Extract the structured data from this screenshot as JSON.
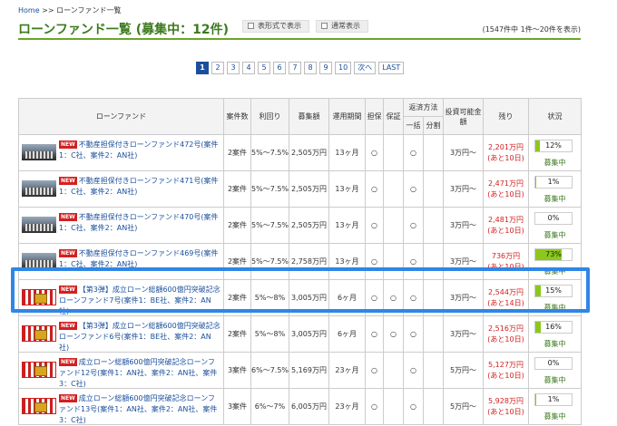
{
  "breadcrumb": {
    "home": "Home",
    "sep": ">>",
    "current": "ローンファンド一覧"
  },
  "title": "ローンファンド一覧 (募集中：12件)",
  "view_buttons": {
    "table": "表形式で表示",
    "normal": "通常表示"
  },
  "result_count": "(1547件中 1件〜20件を表示)",
  "pager": {
    "pages": [
      "1",
      "2",
      "3",
      "4",
      "5",
      "6",
      "7",
      "8",
      "9",
      "10"
    ],
    "current": "1",
    "next": "次へ",
    "last": "LAST"
  },
  "table": {
    "headers": {
      "fund": "ローンファンド",
      "cases": "案件数",
      "yield": "利回り",
      "amount": "募集額",
      "period": "運用期間",
      "collateral": "担保",
      "guarantee": "保証",
      "repayment": "返済方法",
      "lump": "一括",
      "installment": "分割",
      "min_invest": "投資可能金額",
      "remaining": "残り",
      "status": "状況"
    },
    "rows": [
      {
        "thumb": "city",
        "badge": "NEW",
        "name": "不動産担保付きローンファンド472号(案件1：C社、案件2：AN社)",
        "cases": "2案件",
        "yield": "5%〜7.5%",
        "amount": "2,505万円",
        "period": "13ヶ月",
        "collateral": "○",
        "guarantee": "",
        "lump": "○",
        "installment": "",
        "min_invest": "3万円〜",
        "remaining": "2,201万円",
        "remaining_days": "(あと10日)",
        "progress_label": "12%",
        "progress": 12,
        "status": "募集中"
      },
      {
        "thumb": "city",
        "badge": "NEW",
        "name": "不動産担保付きローンファンド471号(案件1：C社、案件2：AN社)",
        "cases": "2案件",
        "yield": "5%〜7.5%",
        "amount": "2,505万円",
        "period": "13ヶ月",
        "collateral": "○",
        "guarantee": "",
        "lump": "○",
        "installment": "",
        "min_invest": "3万円〜",
        "remaining": "2,471万円",
        "remaining_days": "(あと10日)",
        "progress_label": "1%",
        "progress": 1,
        "status": "募集中"
      },
      {
        "thumb": "city",
        "badge": "NEW",
        "name": "不動産担保付きローンファンド470号(案件1：C社、案件2：AN社)",
        "cases": "2案件",
        "yield": "5%〜7.5%",
        "amount": "2,505万円",
        "period": "13ヶ月",
        "collateral": "○",
        "guarantee": "",
        "lump": "○",
        "installment": "",
        "min_invest": "3万円〜",
        "remaining": "2,481万円",
        "remaining_days": "(あと10日)",
        "progress_label": "0%",
        "progress": 0,
        "status": "募集中"
      },
      {
        "thumb": "city",
        "badge": "NEW",
        "name": "不動産担保付きローンファンド469号(案件1：C社、案件2：AN社)",
        "cases": "2案件",
        "yield": "5%〜7.5%",
        "amount": "2,758万円",
        "period": "13ヶ月",
        "collateral": "○",
        "guarantee": "",
        "lump": "○",
        "installment": "",
        "min_invest": "3万円〜",
        "remaining": "736万円",
        "remaining_days": "(あと10日)",
        "progress_label": "73%",
        "progress": 73,
        "status": "募集中"
      },
      {
        "thumb": "red",
        "badge": "NEW",
        "name": "【第3弾】成立ローン総額600億円突破記念ローンファンド7号(案件1：BE社、案件2：AN社)",
        "cases": "2案件",
        "yield": "5%〜8%",
        "amount": "3,005万円",
        "period": "6ヶ月",
        "collateral": "○",
        "guarantee": "○",
        "lump": "○",
        "installment": "",
        "min_invest": "3万円〜",
        "remaining": "2,544万円",
        "remaining_days": "(あと14日)",
        "progress_label": "15%",
        "progress": 15,
        "status": "募集中"
      },
      {
        "thumb": "red",
        "badge": "NEW",
        "name": "【第3弾】成立ローン総額600億円突破記念ローンファンド6号(案件1：BE社、案件2：AN社)",
        "cases": "2案件",
        "yield": "5%〜8%",
        "amount": "3,005万円",
        "period": "6ヶ月",
        "collateral": "○",
        "guarantee": "○",
        "lump": "○",
        "installment": "",
        "min_invest": "3万円〜",
        "remaining": "2,516万円",
        "remaining_days": "(あと10日)",
        "progress_label": "16%",
        "progress": 16,
        "status": "募集中"
      },
      {
        "thumb": "red",
        "badge": "NEW",
        "name": "成立ローン総額600億円突破記念ローンファンド12号(案件1：AN社、案件2：AN社、案件3：C社)",
        "cases": "3案件",
        "yield": "6%〜7.5%",
        "amount": "5,169万円",
        "period": "23ヶ月",
        "collateral": "○",
        "guarantee": "",
        "lump": "○",
        "installment": "",
        "min_invest": "5万円〜",
        "remaining": "5,127万円",
        "remaining_days": "(あと10日)",
        "progress_label": "0%",
        "progress": 0,
        "status": "募集中"
      },
      {
        "thumb": "red",
        "badge": "NEW",
        "name": "成立ローン総額600億円突破記念ローンファンド13号(案件1：AN社、案件2：AN社、案件3：C社)",
        "cases": "3案件",
        "yield": "6%〜7%",
        "amount": "6,005万円",
        "period": "23ヶ月",
        "collateral": "○",
        "guarantee": "",
        "lump": "○",
        "installment": "",
        "min_invest": "5万円〜",
        "remaining": "5,928万円",
        "remaining_days": "(あと10日)",
        "progress_label": "1%",
        "progress": 1,
        "status": "募集中"
      }
    ]
  },
  "colors": {
    "accent_green": "#3c7a1e",
    "progress_green": "#8cc81c",
    "remaining_red": "#d32020",
    "link_blue": "#1a4f9c",
    "highlight_blue": "#2f86e6"
  }
}
